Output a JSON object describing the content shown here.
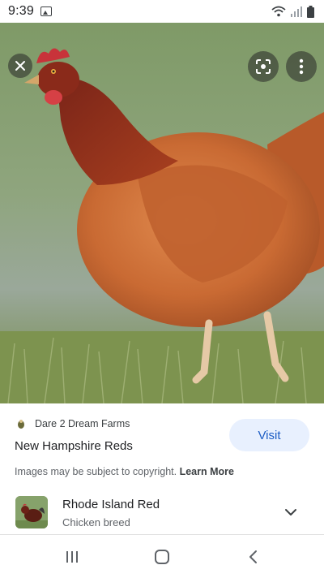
{
  "status_bar": {
    "time": "9:39",
    "icons": [
      "gallery-icon",
      "wifi-icon",
      "signal-icon",
      "battery-icon"
    ]
  },
  "image_viewer": {
    "buttons": [
      "close-icon",
      "lens-icon",
      "more-vert-icon"
    ]
  },
  "result": {
    "source_name": "Dare 2 Dream Farms",
    "title": "New Hampshire Reds",
    "visit_label": "Visit",
    "copyright_text": "Images may be subject to copyright.",
    "learn_more_label": "Learn More"
  },
  "related_entity": {
    "title": "Rhode Island Red",
    "subtitle": "Chicken breed"
  },
  "colors": {
    "visit_bg": "#e8f0fe",
    "visit_text": "#1a5bc4",
    "text_primary": "#202124",
    "text_secondary": "#5f6368"
  }
}
